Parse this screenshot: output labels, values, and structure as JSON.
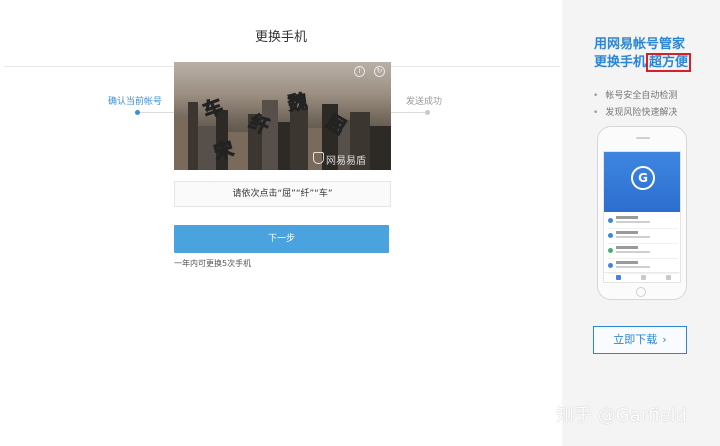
{
  "main": {
    "title": "更换手机",
    "steps": [
      {
        "label": "确认当前帐号",
        "state": "active"
      },
      {
        "label": "发送成功",
        "state": "pending"
      }
    ],
    "captcha": {
      "chars": [
        {
          "text": "车",
          "color": "#3aa6d6"
        },
        {
          "text": "纤",
          "color": "#8bcf2a"
        },
        {
          "text": "魏",
          "color": "#c8e61f"
        },
        {
          "text": "屈",
          "color": "#4ec6c6"
        },
        {
          "text": "宋",
          "color": "#e68a20"
        }
      ],
      "watermark": "网易易盾"
    },
    "instruction": "请依次点击“屈”“纤”“车”",
    "next_label": "下一步",
    "hint": "一年内可更换5次手机"
  },
  "promo": {
    "title_line1": "用网易帐号管家",
    "title_line2_a": "更换手机",
    "title_line2_b": "超方便",
    "bullets": [
      "帐号安全自动检测",
      "发现风险快速解决"
    ],
    "download_label": "立即下载",
    "download_icon": "chevron-right-icon",
    "accent_color": "#2b86d4"
  },
  "watermark": "知乎 @Garfield"
}
